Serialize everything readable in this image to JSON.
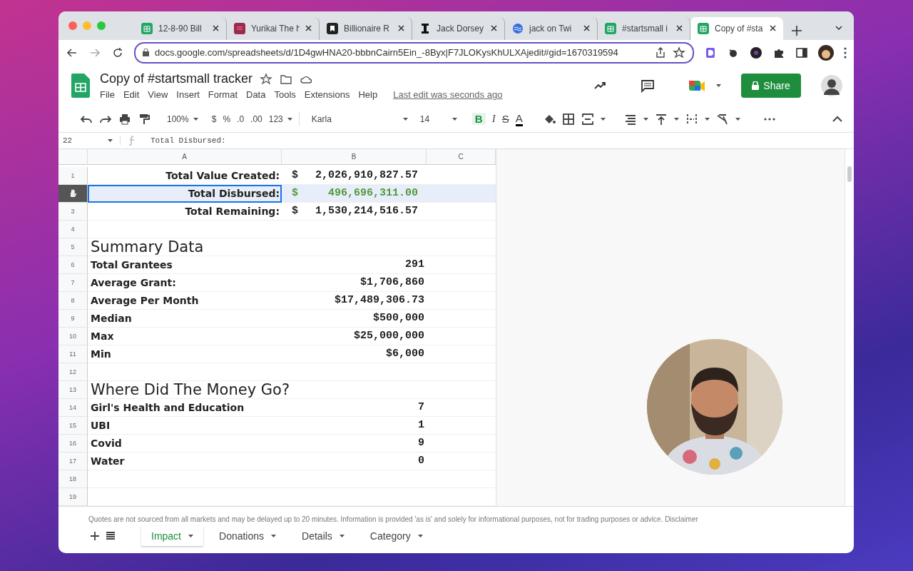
{
  "browser": {
    "tabs": [
      {
        "title": "12-8-90 Bill",
        "selected": false
      },
      {
        "title": "Yurikai The h",
        "selected": false
      },
      {
        "title": "Billionaire R",
        "selected": false
      },
      {
        "title": "Jack Dorsey",
        "selected": false
      },
      {
        "title": "jack on Twi",
        "selected": false
      },
      {
        "title": "#startsmall i",
        "selected": false
      },
      {
        "title": "Copy of #sta",
        "selected": true
      }
    ],
    "url": "docs.google.com/spreadsheets/d/1D4gwHNA20-bbbnCairn5Ein_-8Byx|F7JLOKysKhULXAjedit#gid=1670319594"
  },
  "doc": {
    "title": "Copy of #startsmall tracker",
    "menus": [
      "File",
      "Edit",
      "View",
      "Insert",
      "Format",
      "Data",
      "Tools",
      "Extensions",
      "Help"
    ],
    "last_edit": "Last edit was seconds ago",
    "share": "Share"
  },
  "toolbar": {
    "zoom": "100%",
    "currency": "$",
    "percent": "%",
    "decrease_decimals": ".0",
    "increase_decimals": ".00",
    "number_format": "123",
    "font": "Karla",
    "font_size": "14",
    "bold": "B",
    "italic": "I",
    "strike": "S",
    "text_color": "A"
  },
  "formula_bar": {
    "cell": "22",
    "content": "Total Disbursed:"
  },
  "columns": [
    "A",
    "B",
    "C"
  ],
  "rows": [
    {
      "number": "1",
      "kind": "total",
      "selected": false,
      "label": "Total Value Created:",
      "currency": "$",
      "amount": "2,026,910,827.57"
    },
    {
      "kind": "total",
      "selected": true,
      "label": "Total Disbursed:",
      "currency": "$",
      "amount": "496,696,311.00",
      "color": "#4f9a3c"
    },
    {
      "number": "3",
      "kind": "total",
      "selected": false,
      "label": "Total Remaining:",
      "currency": "$",
      "amount": "1,530,214,516.57"
    },
    {
      "number": "4",
      "kind": "empty",
      "selected": false
    },
    {
      "number": "5",
      "kind": "heading",
      "selected": false,
      "label": "Summary Data"
    },
    {
      "number": "6",
      "kind": "item",
      "selected": false,
      "label": "Total Grantees",
      "value": "291"
    },
    {
      "number": "7",
      "kind": "item",
      "selected": false,
      "label": "Average Grant:",
      "value": "$1,706,860"
    },
    {
      "number": "8",
      "kind": "item",
      "selected": false,
      "label": "Average Per Month",
      "value": "$17,489,306.73"
    },
    {
      "number": "9",
      "kind": "item",
      "selected": false,
      "label": "Median",
      "value": "$500,000"
    },
    {
      "number": "10",
      "kind": "item",
      "selected": false,
      "label": "Max",
      "value": "$25,000,000"
    },
    {
      "number": "11",
      "kind": "item",
      "selected": false,
      "label": "Min",
      "value": "$6,000"
    },
    {
      "number": "12",
      "kind": "empty",
      "selected": false
    },
    {
      "number": "13",
      "kind": "heading",
      "selected": false,
      "label": "Where Did The Money Go?"
    },
    {
      "number": "14",
      "kind": "item",
      "selected": false,
      "label": "Girl's Health and Education",
      "value": "7"
    },
    {
      "number": "15",
      "kind": "item",
      "selected": false,
      "label": "UBI",
      "value": "1"
    },
    {
      "number": "16",
      "kind": "item",
      "selected": false,
      "label": "Covid",
      "value": "9"
    },
    {
      "number": "17",
      "kind": "item",
      "selected": false,
      "label": "Water",
      "value": "0"
    },
    {
      "number": "18",
      "kind": "empty",
      "selected": false
    },
    {
      "number": "19",
      "kind": "empty",
      "selected": false
    }
  ],
  "webcam": {
    "kind": "picture"
  },
  "footer": {
    "disclaimer": "Quotes are not sourced from all markets and may be delayed up to 20 minutes. Information is provided 'as is' and solely for informational purposes, not for trading purposes or advice. Disclaimer",
    "sheets": [
      {
        "label": "Impact",
        "selected": true
      },
      {
        "label": "Donations",
        "selected": false
      },
      {
        "label": "Details",
        "selected": false
      },
      {
        "label": "Category",
        "selected": false
      }
    ]
  }
}
